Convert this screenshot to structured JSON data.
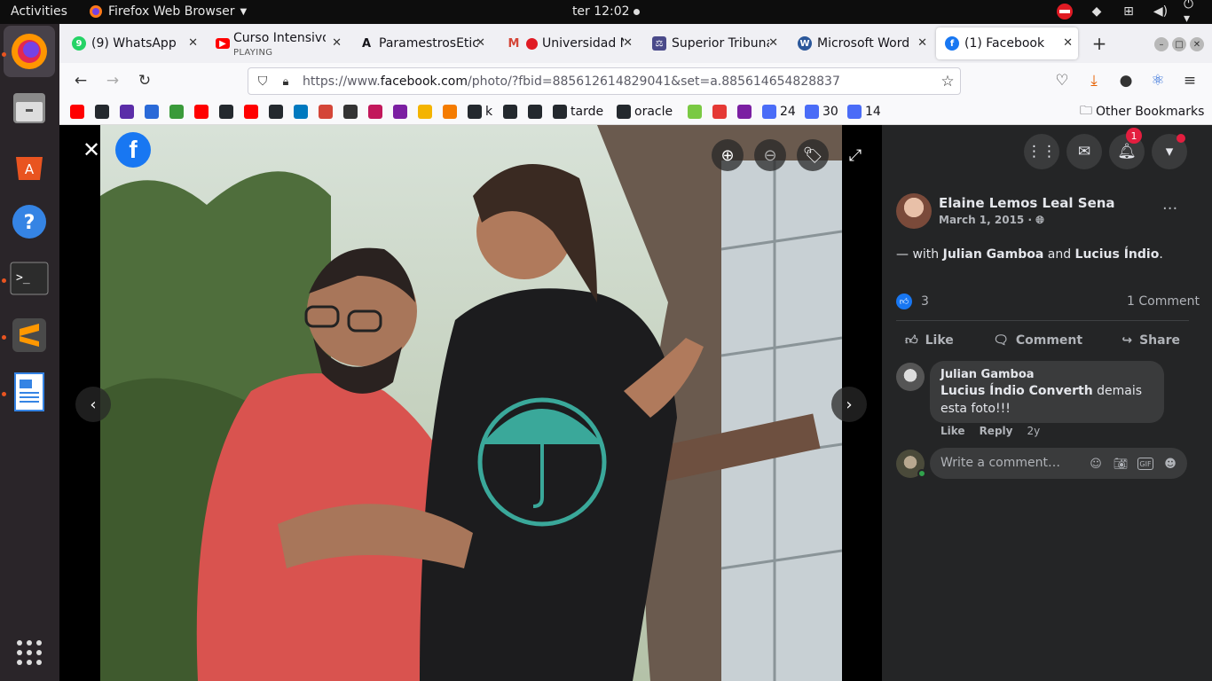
{
  "topbar": {
    "activities": "Activities",
    "app_name": "Firefox Web Browser",
    "clock": "ter 12:02"
  },
  "tabs": [
    {
      "title": "(9) WhatsApp",
      "icon": "whatsapp-icon"
    },
    {
      "title": "Curso Intensivo",
      "subtitle": "PLAYING",
      "icon": "youtube-icon"
    },
    {
      "title": "ParamestrosEtic",
      "icon": "a-logo-icon"
    },
    {
      "title": "Universidad N",
      "icon": "gmail-icon"
    },
    {
      "title": "Superior Tribuna",
      "icon": "court-icon"
    },
    {
      "title": "Microsoft Word",
      "icon": "word-icon"
    },
    {
      "title": "(1) Facebook",
      "icon": "facebook-icon",
      "active": true
    }
  ],
  "navbar": {
    "url_prefix": "https://www.",
    "url_domain": "facebook.com",
    "url_rest": "/photo/?fbid=885612614829041&set=a.885614654828837"
  },
  "bookmarks": [
    {
      "label": "",
      "icon": "youtube-icon",
      "color": "#ff0000"
    },
    {
      "label": "",
      "icon": "github-icon",
      "color": "#24292e"
    },
    {
      "label": "",
      "icon": "chart-icon",
      "color": "#5b2da8"
    },
    {
      "label": "",
      "icon": "play-icon",
      "color": "#2a6ad8"
    },
    {
      "label": "",
      "icon": "leaf-icon",
      "color": "#3a9a3a"
    },
    {
      "label": "",
      "icon": "youtube-icon",
      "color": "#ff0000"
    },
    {
      "label": "",
      "icon": "github-icon",
      "color": "#24292e"
    },
    {
      "label": "",
      "icon": "youtube-icon",
      "color": "#ff0000"
    },
    {
      "label": "",
      "icon": "github-icon",
      "color": "#24292e"
    },
    {
      "label": "",
      "icon": "trello-icon",
      "color": "#0079bf"
    },
    {
      "label": "",
      "icon": "gmail-icon",
      "color": "#d44638"
    },
    {
      "label": "",
      "icon": "diamond-icon",
      "color": "#333333"
    },
    {
      "label": "",
      "icon": "swirl-icon",
      "color": "#c2185b"
    },
    {
      "label": "",
      "icon": "u-icon",
      "color": "#7b1fa2"
    },
    {
      "label": "",
      "icon": "drive-icon",
      "color": "#f4b400"
    },
    {
      "label": "",
      "icon": "box-icon",
      "color": "#f57c00"
    },
    {
      "label": "k",
      "icon": "github-icon",
      "color": "#24292e"
    },
    {
      "label": "",
      "icon": "github-icon",
      "color": "#24292e"
    },
    {
      "label": "",
      "icon": "github-icon",
      "color": "#24292e"
    },
    {
      "label": "tarde",
      "icon": "github-icon",
      "color": "#24292e"
    },
    {
      "label": "oracle",
      "icon": "github-icon",
      "color": "#24292e"
    },
    {
      "label": "",
      "icon": "smile-icon",
      "color": "#7ac943"
    },
    {
      "label": "",
      "icon": "pill-icon",
      "color": "#e53935"
    },
    {
      "label": "",
      "icon": "u-icon",
      "color": "#7b1fa2"
    },
    {
      "label": "24",
      "icon": "drop-icon",
      "color": "#4a6cf7"
    },
    {
      "label": "30",
      "icon": "drop-icon",
      "color": "#4a6cf7"
    },
    {
      "label": "14",
      "icon": "drop-icon",
      "color": "#4a6cf7"
    }
  ],
  "other_bookmarks": "Other Bookmarks",
  "post": {
    "author": "Elaine Lemos Leal Sena",
    "date": "March 1, 2015",
    "with_prefix": "— with",
    "tag1": "Julian Gamboa",
    "and": "and",
    "tag2": "Lucius Índio",
    "period": ".",
    "reaction_count": "3",
    "comment_count": "1 Comment",
    "like": "Like",
    "comment": "Comment",
    "share": "Share"
  },
  "notification_count": "1",
  "comment": {
    "author": "Julian Gamboa",
    "mention": "Lucius Índio Converth",
    "text_rest": " demais",
    "text_line2": "esta foto!!!",
    "like": "Like",
    "reply": "Reply",
    "age": "2y"
  },
  "write_comment_placeholder": "Write a comment…",
  "colors": {
    "facebook_blue": "#1877f2",
    "panel_bg": "#242526",
    "ubuntu_orange": "#e95420"
  }
}
